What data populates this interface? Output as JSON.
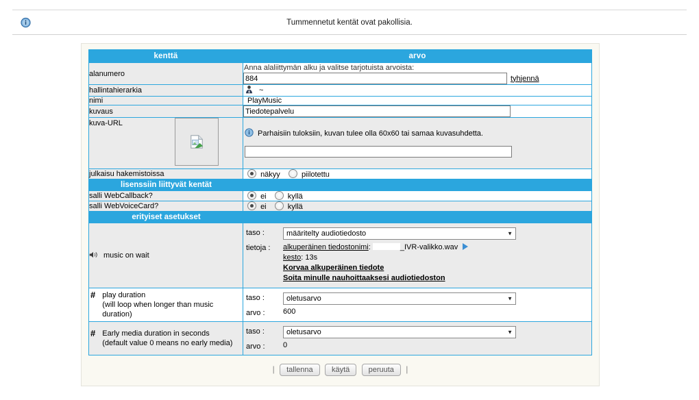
{
  "top": {
    "message": "Tummennetut kentät ovat pakollisia.",
    "info_icon": "info-icon"
  },
  "table": {
    "headers": {
      "field": "kenttä",
      "value": "arvo"
    },
    "rows": {
      "alanumero": {
        "label": "alanumero",
        "hint": "Anna alaliittymän alku ja valitse tarjotuista arvoista:",
        "input_value": "884",
        "clear_link": "tyhjennä"
      },
      "hallintahierarkia": {
        "label": "hallintahierarkia",
        "icon": "user-icon",
        "value": "~"
      },
      "nimi": {
        "label": "nimi",
        "value": "PlayMusic"
      },
      "kuvaus": {
        "label": "kuvaus",
        "input_value": "Tiedotepalvelu"
      },
      "kuva_url": {
        "label": "kuva-URL",
        "placeholder_icon": "broken-image-icon",
        "info_icon": "info-icon",
        "info_text": "Parhaisiin tuloksiin, kuvan tulee olla 60x60 tai samaa kuvasuhdetta.",
        "input_value": ""
      },
      "julkaisu": {
        "label": "julkaisu hakemistoissa",
        "option_1": "näkyy",
        "option_2": "piilotettu",
        "selected": "näkyy"
      }
    },
    "section_license": {
      "title": "lisenssiin liittyvät kentät",
      "webcallback": {
        "label": "salli WebCallback?",
        "option_1": "ei",
        "option_2": "kyllä",
        "selected": "ei"
      },
      "webvoicecard": {
        "label": "salli WebVoiceCard?",
        "option_1": "ei",
        "option_2": "kyllä",
        "selected": "ei"
      }
    },
    "section_special": {
      "title": "erityiset asetukset",
      "music_on_wait": {
        "icon": "speaker-icon",
        "label": "music on wait",
        "taso_label": "taso :",
        "taso_value": "määritelty audiotiedosto",
        "tietoja_label": "tietoja :",
        "filename_label": "alkuperäinen tiedostonimi",
        "filename_sep": ":",
        "filename_value": "_IVR-valikko.wav",
        "play_icon": "play-icon",
        "duration_label": "kesto",
        "duration_sep": ":",
        "duration_value": "13s",
        "link_replace": "Korvaa alkuperäinen tiedote",
        "link_record": "Soita minulle nauhoittaaksesi audiotiedoston"
      },
      "play_duration": {
        "icon": "hash-icon",
        "label": "play duration",
        "sublabel": "(will loop when longer than music duration)",
        "taso_label": "taso :",
        "taso_value": "oletusarvo",
        "arvo_label": "arvo :",
        "arvo_value": "600"
      },
      "early_media": {
        "icon": "hash-icon",
        "label": "Early media duration in seconds",
        "sublabel": "(default value 0 means no early media)",
        "taso_label": "taso :",
        "taso_value": "oletusarvo",
        "arvo_label": "arvo :",
        "arvo_value": "0"
      }
    }
  },
  "footer": {
    "sep_left": "|",
    "save": "tallenna",
    "apply": "käytä",
    "cancel": "peruuta",
    "sep_right": "|"
  },
  "colors": {
    "accent": "#2ba6de",
    "panel_bg": "#faf9f2",
    "row_label_bg": "#ebebeb"
  }
}
